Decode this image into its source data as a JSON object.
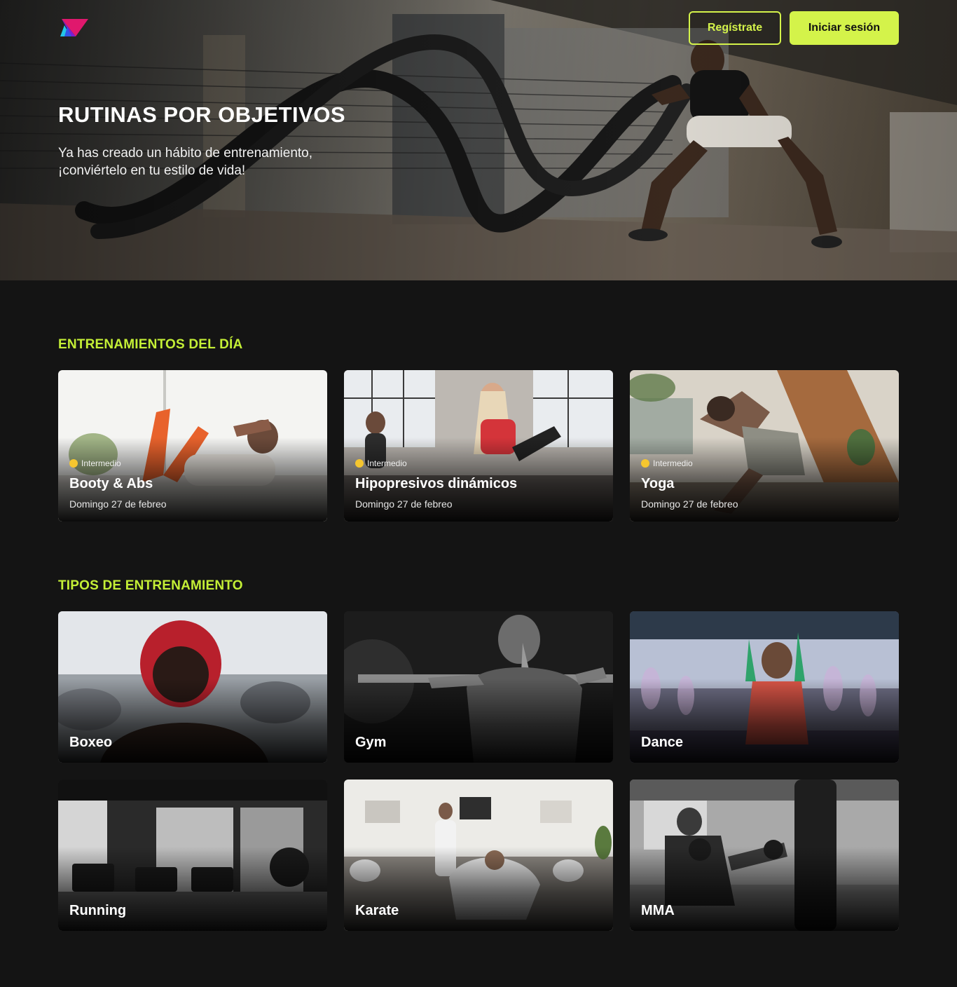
{
  "header": {
    "register_label": "Regístrate",
    "login_label": "Iniciar sesión"
  },
  "hero": {
    "title": "RUTINAS POR OBJETIVOS",
    "subtitle_line1": "Ya has creado un hábito de entrenamiento,",
    "subtitle_line2": "¡conviértelo en tu estilo de vida!"
  },
  "daily": {
    "title": "ENTRENAMIENTOS DEL DÍA",
    "cards": [
      {
        "level": "Intermedio",
        "title": "Booty & Abs",
        "date": "Domingo 27 de febreo"
      },
      {
        "level": "Intermedio",
        "title": "Hipopresivos dinámicos",
        "date": "Domingo 27 de febreo"
      },
      {
        "level": "Intermedio",
        "title": "Yoga",
        "date": "Domingo 27 de febreo"
      }
    ]
  },
  "types": {
    "title": "TIPOS DE ENTRENAMIENTO",
    "cards": [
      {
        "title": "Boxeo"
      },
      {
        "title": "Gym"
      },
      {
        "title": "Dance"
      },
      {
        "title": "Running"
      },
      {
        "title": "Karate"
      },
      {
        "title": "MMA"
      }
    ]
  },
  "colors": {
    "accent": "#d4f34a",
    "section_title": "#c4ef36",
    "level_dot": "#f5c62f",
    "background": "#141414"
  }
}
